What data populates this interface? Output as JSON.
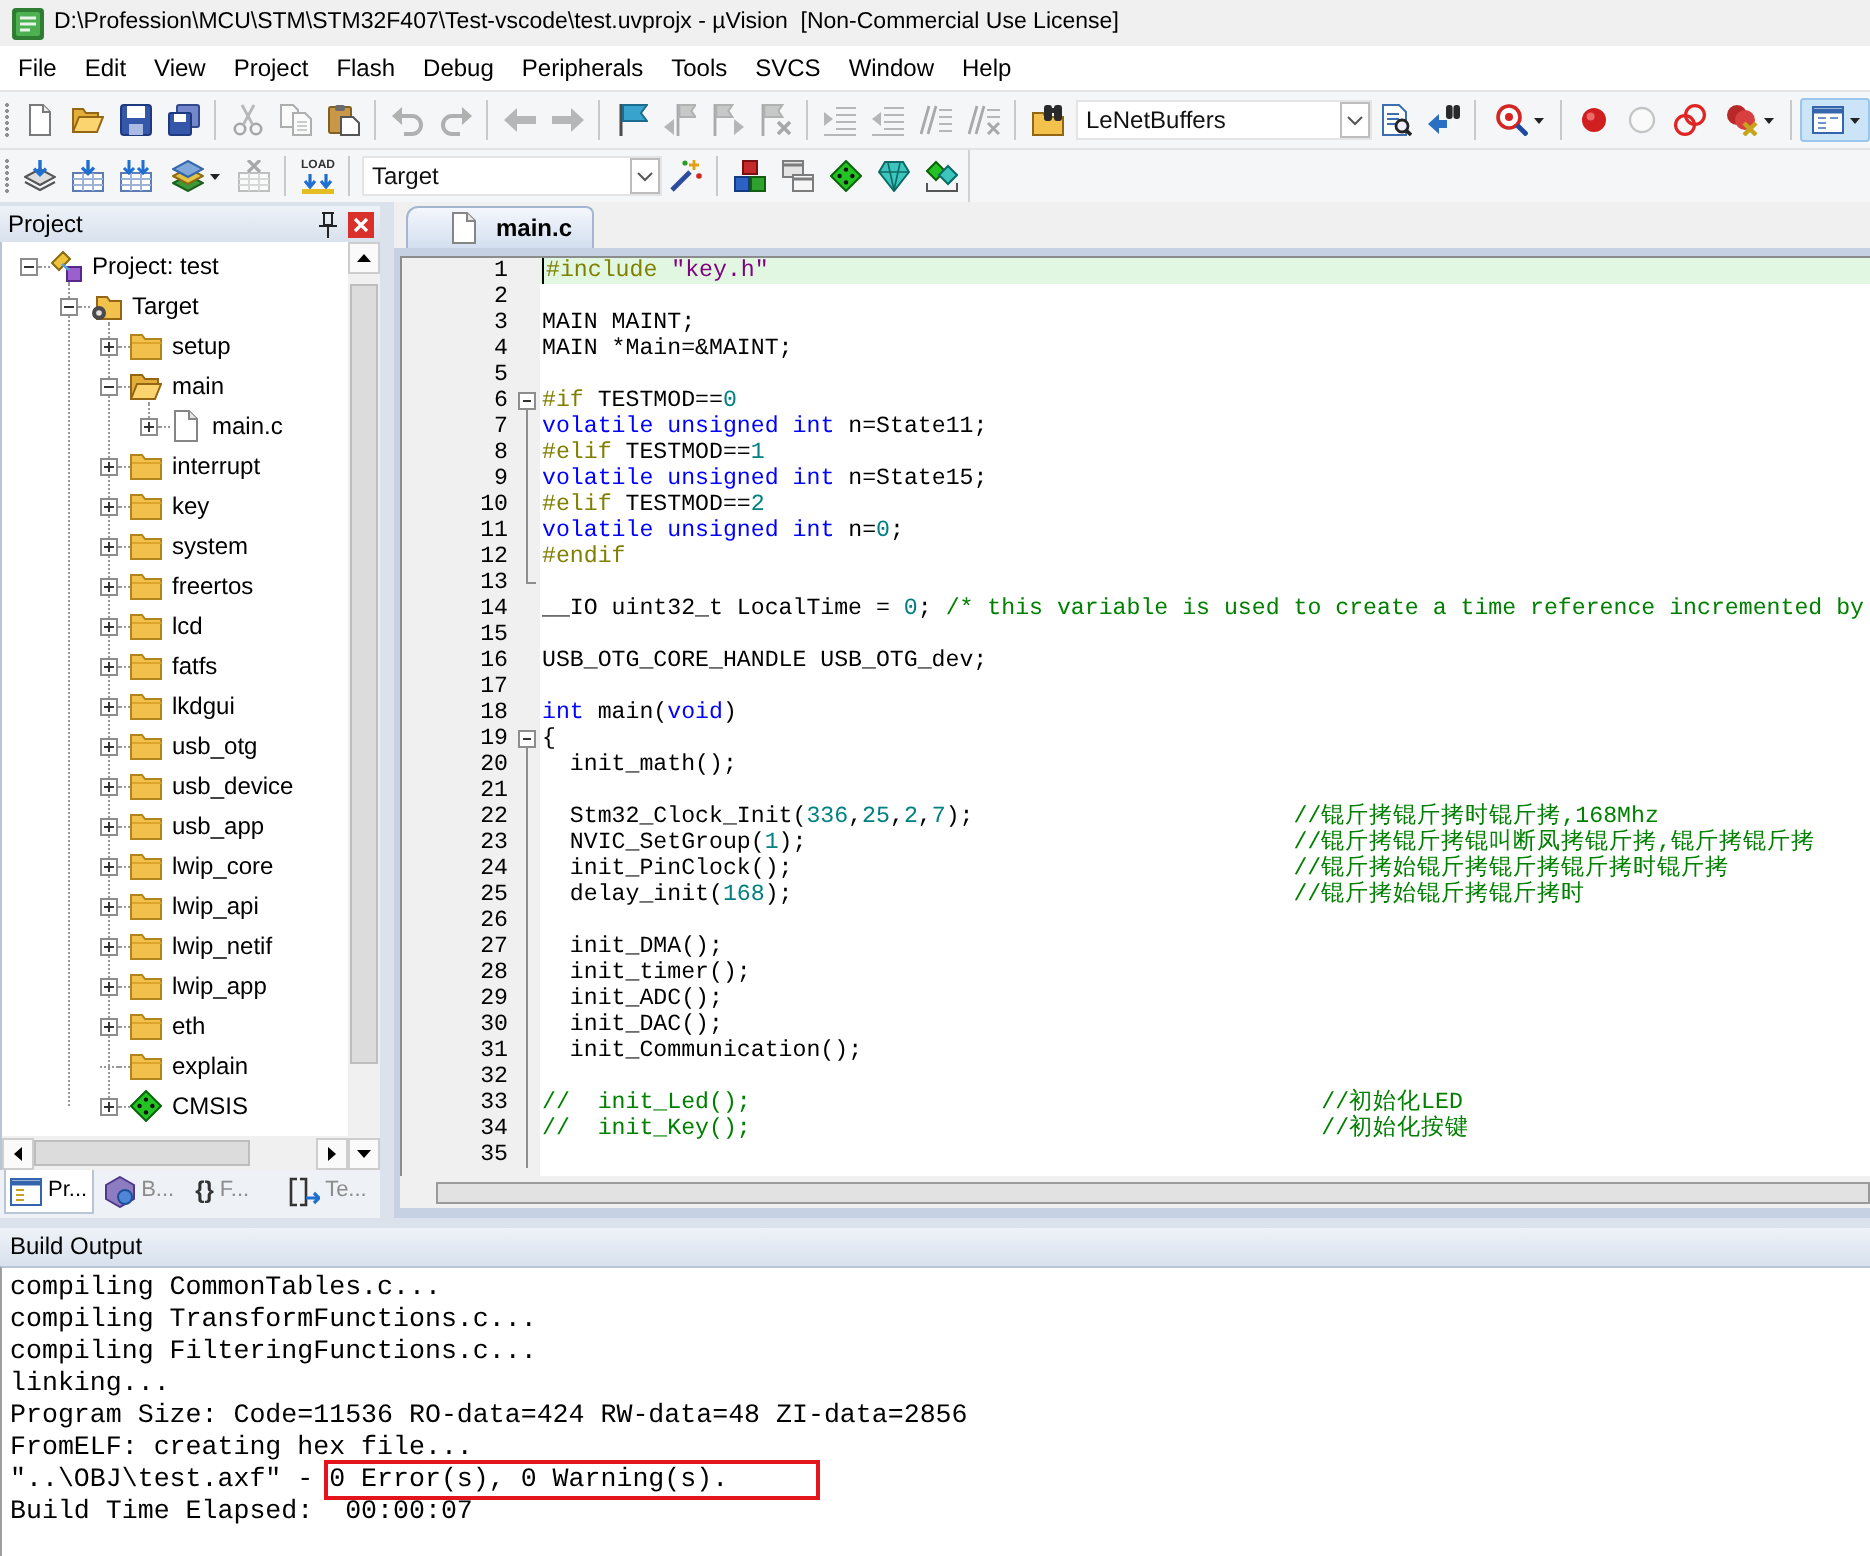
{
  "window": {
    "title": "D:\\Profession\\MCU\\STM\\STM32F407\\Test-vscode\\test.uvprojx - µVision  [Non-Commercial Use License]"
  },
  "menu": [
    "File",
    "Edit",
    "View",
    "Project",
    "Flash",
    "Debug",
    "Peripherals",
    "Tools",
    "SVCS",
    "Window",
    "Help"
  ],
  "toolbars": [
    {
      "items": [
        {
          "kind": "button",
          "disabled": false,
          "pressed": false
        },
        {
          "kind": "button",
          "disabled": false,
          "pressed": false
        },
        {
          "kind": "button",
          "disabled": false,
          "pressed": false
        },
        {
          "kind": "button",
          "disabled": false,
          "pressed": false
        },
        {
          "kind": "separator"
        },
        {
          "kind": "button",
          "disabled": true,
          "pressed": false
        },
        {
          "kind": "button",
          "disabled": true,
          "pressed": false
        },
        {
          "kind": "button",
          "disabled": false,
          "pressed": false
        },
        {
          "kind": "separator"
        },
        {
          "kind": "button",
          "disabled": true,
          "pressed": false
        },
        {
          "kind": "button",
          "disabled": true,
          "pressed": false
        },
        {
          "kind": "separator"
        },
        {
          "kind": "button",
          "disabled": true,
          "pressed": false
        },
        {
          "kind": "button",
          "disabled": true,
          "pressed": false
        },
        {
          "kind": "separator"
        },
        {
          "kind": "button",
          "disabled": false,
          "pressed": false
        },
        {
          "kind": "button",
          "disabled": true,
          "pressed": false
        },
        {
          "kind": "button",
          "disabled": true,
          "pressed": false
        },
        {
          "kind": "button",
          "disabled": true,
          "pressed": false
        },
        {
          "kind": "separator"
        },
        {
          "kind": "button",
          "disabled": true,
          "pressed": false
        },
        {
          "kind": "button",
          "disabled": true,
          "pressed": false
        },
        {
          "kind": "button",
          "disabled": true,
          "pressed": false
        },
        {
          "kind": "button",
          "disabled": true,
          "pressed": false
        },
        {
          "kind": "separator"
        },
        {
          "kind": "button",
          "disabled": false,
          "pressed": false
        },
        {
          "kind": "combo",
          "value": "LeNetBuffers"
        },
        {
          "kind": "button",
          "disabled": false,
          "pressed": false
        },
        {
          "kind": "button",
          "disabled": false,
          "pressed": false
        },
        {
          "kind": "separator"
        },
        {
          "kind": "button",
          "disabled": false,
          "pressed": false
        },
        {
          "kind": "separator"
        },
        {
          "kind": "button",
          "disabled": false,
          "pressed": false
        },
        {
          "kind": "button",
          "disabled": true,
          "pressed": false
        },
        {
          "kind": "button",
          "disabled": false,
          "pressed": false
        },
        {
          "kind": "button",
          "disabled": false,
          "pressed": false
        },
        {
          "kind": "separator"
        },
        {
          "kind": "button",
          "disabled": false,
          "pressed": true
        }
      ]
    },
    {
      "items": [
        {
          "kind": "button",
          "disabled": false,
          "pressed": false
        },
        {
          "kind": "button",
          "disabled": false,
          "pressed": false
        },
        {
          "kind": "button",
          "disabled": false,
          "pressed": false
        },
        {
          "kind": "button",
          "disabled": false,
          "pressed": false
        },
        {
          "kind": "button",
          "disabled": true,
          "pressed": false
        },
        {
          "kind": "separator"
        },
        {
          "kind": "button",
          "disabled": false,
          "pressed": false,
          "caption": "LOAD"
        },
        {
          "kind": "separator"
        },
        {
          "kind": "combo",
          "value": "Target"
        },
        {
          "kind": "button",
          "disabled": false,
          "pressed": false
        },
        {
          "kind": "separator"
        },
        {
          "kind": "button",
          "disabled": false,
          "pressed": false
        },
        {
          "kind": "button",
          "disabled": false,
          "pressed": false
        },
        {
          "kind": "button",
          "disabled": false,
          "pressed": false
        },
        {
          "kind": "button",
          "disabled": false,
          "pressed": false
        },
        {
          "kind": "button",
          "disabled": false,
          "pressed": false
        }
      ]
    }
  ],
  "project_panel": {
    "title": "Project",
    "tree": [
      {
        "label": "Project: test",
        "kind": "project",
        "expanded": true,
        "children": [
          {
            "label": "Target",
            "kind": "target",
            "expanded": true,
            "children": [
              {
                "label": "setup",
                "kind": "folder",
                "expanded": false
              },
              {
                "label": "main",
                "kind": "folder",
                "expanded": true,
                "children": [
                  {
                    "label": "main.c",
                    "kind": "file",
                    "expanded": false
                  }
                ]
              },
              {
                "label": "interrupt",
                "kind": "folder",
                "expanded": false
              },
              {
                "label": "key",
                "kind": "folder",
                "expanded": false
              },
              {
                "label": "system",
                "kind": "folder",
                "expanded": false
              },
              {
                "label": "freertos",
                "kind": "folder",
                "expanded": false
              },
              {
                "label": "lcd",
                "kind": "folder",
                "expanded": false
              },
              {
                "label": "fatfs",
                "kind": "folder",
                "expanded": false
              },
              {
                "label": "lkdgui",
                "kind": "folder",
                "expanded": false
              },
              {
                "label": "usb_otg",
                "kind": "folder",
                "expanded": false
              },
              {
                "label": "usb_device",
                "kind": "folder",
                "expanded": false
              },
              {
                "label": "usb_app",
                "kind": "folder",
                "expanded": false
              },
              {
                "label": "lwip_core",
                "kind": "folder",
                "expanded": false
              },
              {
                "label": "lwip_api",
                "kind": "folder",
                "expanded": false
              },
              {
                "label": "lwip_netif",
                "kind": "folder",
                "expanded": false
              },
              {
                "label": "lwip_app",
                "kind": "folder",
                "expanded": false
              },
              {
                "label": "eth",
                "kind": "folder",
                "expanded": false
              },
              {
                "label": "explain",
                "kind": "empty_folder"
              },
              {
                "label": "CMSIS",
                "kind": "component",
                "expanded": false
              }
            ]
          }
        ]
      }
    ],
    "tabs": [
      {
        "label": "Pr...",
        "selected": true
      },
      {
        "label": "B...",
        "selected": false
      },
      {
        "glyph": "{}",
        "label": "F...",
        "selected": false
      },
      {
        "label": "Te...",
        "selected": false
      }
    ]
  },
  "editor": {
    "tabs": [
      {
        "label": "main.c",
        "selected": true
      }
    ],
    "lines": [
      {
        "number": "1",
        "kind": "plain",
        "current": true,
        "tokens": [
          {
            "kind": "directive",
            "text": "#include"
          },
          {
            "kind": "string",
            "text": " \"key.h\""
          }
        ]
      },
      {
        "number": "2",
        "kind": "plain",
        "current": false
      },
      {
        "number": "3",
        "kind": "plain",
        "current": false,
        "tokens": [
          {
            "kind": "text",
            "text": "MAIN MAINT;"
          }
        ]
      },
      {
        "number": "4",
        "kind": "plain",
        "current": false,
        "tokens": [
          {
            "kind": "text",
            "text": "MAIN *Main=&MAINT;"
          }
        ]
      },
      {
        "number": "5",
        "kind": "plain",
        "current": false
      },
      {
        "number": "6",
        "kind": "fold_start",
        "current": false,
        "tokens": [
          {
            "kind": "directive",
            "text": "#if"
          },
          {
            "kind": "text",
            "text": " TESTMOD=="
          },
          {
            "kind": "number",
            "text": "0"
          }
        ]
      },
      {
        "number": "7",
        "kind": "fold_body",
        "current": false,
        "tokens": [
          {
            "kind": "keyword",
            "text": "volatile"
          },
          {
            "kind": "keyword",
            "text": " unsigned"
          },
          {
            "kind": "keyword",
            "text": " int"
          },
          {
            "kind": "text",
            "text": " n=State11;"
          }
        ]
      },
      {
        "number": "8",
        "kind": "fold_body",
        "current": false,
        "tokens": [
          {
            "kind": "directive",
            "text": "#elif"
          },
          {
            "kind": "text",
            "text": " TESTMOD=="
          },
          {
            "kind": "number",
            "text": "1"
          }
        ]
      },
      {
        "number": "9",
        "kind": "fold_body",
        "current": false,
        "tokens": [
          {
            "kind": "keyword",
            "text": "volatile"
          },
          {
            "kind": "keyword",
            "text": " unsigned"
          },
          {
            "kind": "keyword",
            "text": " int"
          },
          {
            "kind": "text",
            "text": " n=State15;"
          }
        ]
      },
      {
        "number": "10",
        "kind": "fold_body",
        "current": false,
        "tokens": [
          {
            "kind": "directive",
            "text": "#elif"
          },
          {
            "kind": "text",
            "text": " TESTMOD=="
          },
          {
            "kind": "number",
            "text": "2"
          }
        ]
      },
      {
        "number": "11",
        "kind": "fold_body",
        "current": false,
        "tokens": [
          {
            "kind": "keyword",
            "text": "volatile"
          },
          {
            "kind": "keyword",
            "text": " unsigned"
          },
          {
            "kind": "keyword",
            "text": " int"
          },
          {
            "kind": "text",
            "text": " n="
          },
          {
            "kind": "number",
            "text": "0"
          },
          {
            "kind": "text",
            "text": ";"
          }
        ]
      },
      {
        "number": "12",
        "kind": "fold_body",
        "current": false,
        "tokens": [
          {
            "kind": "directive",
            "text": "#endif"
          }
        ]
      },
      {
        "number": "13",
        "kind": "fold_end",
        "current": false
      },
      {
        "number": "14",
        "kind": "plain",
        "current": false,
        "tokens": [
          {
            "kind": "text",
            "text": "__IO uint32_t LocalTime ="
          },
          {
            "kind": "number",
            "text": " 0"
          },
          {
            "kind": "text",
            "text": ";"
          },
          {
            "kind": "comment",
            "text": " /* this variable is used to create a time reference incremented by"
          }
        ]
      },
      {
        "number": "15",
        "kind": "plain",
        "current": false
      },
      {
        "number": "16",
        "kind": "plain",
        "current": false,
        "tokens": [
          {
            "kind": "text",
            "text": "USB_OTG_CORE_HANDLE USB_OTG_dev;"
          }
        ]
      },
      {
        "number": "17",
        "kind": "plain",
        "current": false
      },
      {
        "number": "18",
        "kind": "plain",
        "current": false,
        "tokens": [
          {
            "kind": "keyword",
            "text": "int"
          },
          {
            "kind": "text",
            "text": " main("
          },
          {
            "kind": "keyword",
            "text": "void"
          },
          {
            "kind": "text",
            "text": ")"
          }
        ]
      },
      {
        "number": "19",
        "kind": "fold_start",
        "current": false,
        "tokens": [
          {
            "kind": "text",
            "text": "{"
          }
        ]
      },
      {
        "number": "20",
        "kind": "fold_body",
        "current": false,
        "tokens": [
          {
            "kind": "text",
            "text": "  init_math();"
          }
        ]
      },
      {
        "number": "21",
        "kind": "fold_body",
        "current": false
      },
      {
        "number": "22",
        "kind": "fold_body",
        "current": false,
        "tokens": [
          {
            "kind": "text",
            "text": "  Stm32_Clock_Init("
          },
          {
            "kind": "number",
            "text": "336"
          },
          {
            "kind": "text",
            "text": ","
          },
          {
            "kind": "number",
            "text": "25"
          },
          {
            "kind": "text",
            "text": ","
          },
          {
            "kind": "number",
            "text": "2"
          },
          {
            "kind": "text",
            "text": ","
          },
          {
            "kind": "number",
            "text": "7"
          },
          {
            "kind": "text",
            "text": ");"
          },
          {
            "kind": "comment",
            "text": "                       //锟斤拷锟斤拷时锟斤拷,168Mhz"
          }
        ]
      },
      {
        "number": "23",
        "kind": "fold_body",
        "current": false,
        "tokens": [
          {
            "kind": "text",
            "text": "  NVIC_SetGroup("
          },
          {
            "kind": "number",
            "text": "1"
          },
          {
            "kind": "text",
            "text": ");"
          },
          {
            "kind": "comment",
            "text": "                                   //锟斤拷锟斤拷锟叫断凤拷锟斤拷,锟斤拷锟斤拷"
          }
        ]
      },
      {
        "number": "24",
        "kind": "fold_body",
        "current": false,
        "tokens": [
          {
            "kind": "text",
            "text": "  init_PinClock();"
          },
          {
            "kind": "comment",
            "text": "                                    //锟斤拷始锟斤拷锟斤拷锟斤拷时锟斤拷"
          }
        ]
      },
      {
        "number": "25",
        "kind": "fold_body",
        "current": false,
        "tokens": [
          {
            "kind": "text",
            "text": "  delay_init("
          },
          {
            "kind": "number",
            "text": "168"
          },
          {
            "kind": "text",
            "text": ");"
          },
          {
            "kind": "comment",
            "text": "                                    //锟斤拷始锟斤拷锟斤拷时"
          }
        ]
      },
      {
        "number": "26",
        "kind": "fold_body",
        "current": false
      },
      {
        "number": "27",
        "kind": "fold_body",
        "current": false,
        "tokens": [
          {
            "kind": "text",
            "text": "  init_DMA();"
          }
        ]
      },
      {
        "number": "28",
        "kind": "fold_body",
        "current": false,
        "tokens": [
          {
            "kind": "text",
            "text": "  init_timer();"
          }
        ]
      },
      {
        "number": "29",
        "kind": "fold_body",
        "current": false,
        "tokens": [
          {
            "kind": "text",
            "text": "  init_ADC();"
          }
        ]
      },
      {
        "number": "30",
        "kind": "fold_body",
        "current": false,
        "tokens": [
          {
            "kind": "text",
            "text": "  init_DAC();"
          }
        ]
      },
      {
        "number": "31",
        "kind": "fold_body",
        "current": false,
        "tokens": [
          {
            "kind": "text",
            "text": "  init_Communication();"
          }
        ]
      },
      {
        "number": "32",
        "kind": "fold_body",
        "current": false
      },
      {
        "number": "33",
        "kind": "fold_body",
        "current": false,
        "tokens": [
          {
            "kind": "comment",
            "text": "//  init_Led();"
          },
          {
            "kind": "comment",
            "text": "                                         //初始化LED"
          }
        ]
      },
      {
        "number": "34",
        "kind": "fold_body",
        "current": false,
        "tokens": [
          {
            "kind": "comment",
            "text": "//  init_Key();"
          },
          {
            "kind": "comment",
            "text": "                                         //初始化按键"
          }
        ]
      },
      {
        "number": "35",
        "kind": "fold_body",
        "current": false
      }
    ]
  },
  "build_output": {
    "title": "Build Output",
    "lines": [
      {
        "parts": [
          {
            "text": "compiling CommonTables.c...",
            "highlighted": false
          }
        ]
      },
      {
        "parts": [
          {
            "text": "compiling TransformFunctions.c...",
            "highlighted": false
          }
        ]
      },
      {
        "parts": [
          {
            "text": "compiling FilteringFunctions.c...",
            "highlighted": false
          }
        ]
      },
      {
        "parts": [
          {
            "text": "linking...",
            "highlighted": false
          }
        ]
      },
      {
        "parts": [
          {
            "text": "Program Size: Code=11536 RO-data=424 RW-data=48 ZI-data=2856",
            "highlighted": false
          }
        ]
      },
      {
        "parts": [
          {
            "text": "FromELF: creating hex file...",
            "highlighted": false
          }
        ]
      },
      {
        "parts": [
          {
            "text": "\"..\\OBJ\\test.axf\" - ",
            "highlighted": false
          },
          {
            "text": "0 Error(s), 0 Warning(s).",
            "highlighted": true
          }
        ]
      },
      {
        "parts": [
          {
            "text": "Build Time Elapsed:  00:00:07",
            "highlighted": false
          }
        ]
      }
    ]
  }
}
